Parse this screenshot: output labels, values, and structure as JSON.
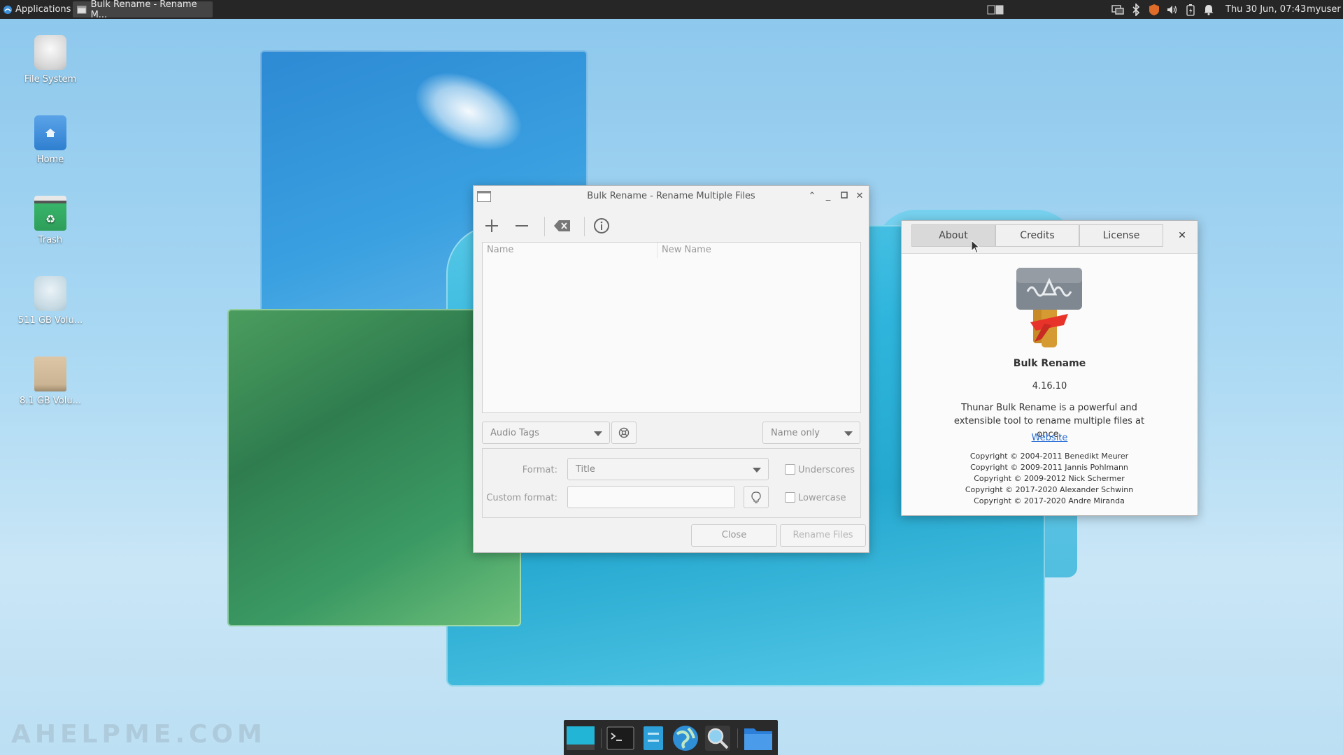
{
  "panel": {
    "applications_label": "Applications",
    "task_label": "Bulk Rename - Rename M...",
    "clock": "Thu 30 Jun, 07:43",
    "user": "myuser",
    "tray_icons": [
      "display-icon",
      "bluetooth-icon",
      "shield-icon",
      "volume-icon",
      "power-icon",
      "bell-icon"
    ]
  },
  "desktop": {
    "icons": [
      {
        "label": "File System"
      },
      {
        "label": "Home"
      },
      {
        "label": "Trash"
      },
      {
        "label": "511 GB Volu..."
      },
      {
        "label": "8.1 GB Volu..."
      }
    ]
  },
  "bulk_rename": {
    "title": "Bulk Rename - Rename Multiple Files",
    "toolbar": [
      "add-icon",
      "remove-icon",
      "clear-icon",
      "info-icon"
    ],
    "columns": [
      "Name",
      "New Name"
    ],
    "renamer_select": "Audio Tags",
    "scope_select": "Name only",
    "format_label": "Format:",
    "format_value": "Title",
    "custom_format_label": "Custom format:",
    "custom_format_value": "",
    "underscores_label": "Underscores",
    "lowercase_label": "Lowercase",
    "underscores_checked": false,
    "lowercase_checked": false,
    "close_button": "Close",
    "rename_button": "Rename Files"
  },
  "about": {
    "tabs": [
      "About",
      "Credits",
      "License"
    ],
    "active_tab": "About",
    "app_name": "Bulk Rename",
    "version": "4.16.10",
    "description": "Thunar Bulk Rename is a powerful and extensible tool to rename multiple files at once.",
    "website_label": "Website",
    "copyrights": [
      "Copyright © 2004-2011 Benedikt Meurer",
      "Copyright © 2009-2011 Jannis Pohlmann",
      "Copyright © 2009-2012 Nick Schermer",
      "Copyright © 2017-2020 Alexander Schwinn",
      "Copyright © 2017-2020 Andre Miranda"
    ]
  },
  "dock": {
    "items": [
      "show-desktop-icon",
      "terminal-icon",
      "file-manager-icon",
      "web-browser-icon",
      "search-icon",
      "folder-icon"
    ]
  },
  "watermark": "AHELPME.COM",
  "colors": {
    "panel": "#262626",
    "link": "#2a6fd6",
    "dock": "#2a2a2a"
  }
}
